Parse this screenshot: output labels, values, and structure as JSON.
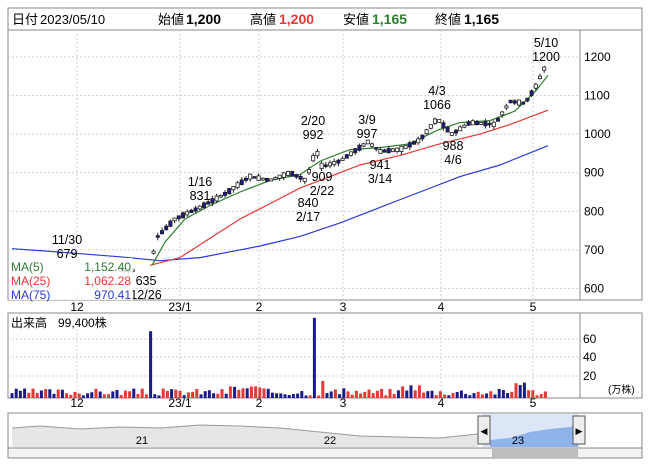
{
  "header": {
    "date_label": "日付",
    "date_value": "2023/05/10",
    "open_label": "始値",
    "open_value": "1,200",
    "high_label": "高値",
    "high_value": "1,200",
    "low_label": "安値",
    "low_value": "1,165",
    "close_label": "終値",
    "close_value": "1,165"
  },
  "legend": {
    "ma5": {
      "label": "MA(5)",
      "value": "1,152.40",
      "color": "#2e7d32"
    },
    "ma25": {
      "label": "MA(25)",
      "value": "1,062.28",
      "color": "#e53935"
    },
    "ma75": {
      "label": "MA(75)",
      "value": "970.41",
      "color": "#2a3bd6"
    }
  },
  "volume": {
    "label": "出来高",
    "value": "99,400株",
    "unit": "(万株)",
    "yticks": [
      "60",
      "40",
      "20"
    ]
  },
  "annotations": [
    {
      "lines": [
        "11/30",
        "679"
      ]
    },
    {
      "lines": [
        "635",
        "12/26"
      ]
    },
    {
      "lines": [
        "1/16",
        "831"
      ]
    },
    {
      "lines": [
        "2/20",
        "992"
      ]
    },
    {
      "lines": [
        "909",
        "2/22"
      ]
    },
    {
      "lines": [
        "840",
        "2/17"
      ]
    },
    {
      "lines": [
        "3/9",
        "997"
      ]
    },
    {
      "lines": [
        "941",
        "3/14"
      ]
    },
    {
      "lines": [
        "4/3",
        "1066"
      ]
    },
    {
      "lines": [
        "988",
        "4/6"
      ]
    },
    {
      "lines": [
        "5/10",
        "1200"
      ]
    }
  ],
  "navigator": {
    "labels": [
      "21",
      "22",
      "23"
    ]
  },
  "colors": {
    "up": "#ffffff",
    "down": "#1a1a8c",
    "ma5": "#2e7d32",
    "ma25": "#e53935",
    "ma75": "#2a3bd6",
    "vol_up": "#e53935",
    "vol_down": "#1a1a8c"
  },
  "chart_data": {
    "type": "candlestick",
    "ylim": [
      570,
      1270
    ],
    "yticks": [
      600,
      700,
      800,
      900,
      1000,
      1100,
      1200
    ],
    "xticks": [
      "12",
      "23/1",
      "2",
      "3",
      "4",
      "5"
    ],
    "anchors": [
      {
        "date": "11/30",
        "price": 679
      },
      {
        "date": "12/26",
        "price": 635
      },
      {
        "date": "1/16",
        "price": 831
      },
      {
        "date": "2/17",
        "price": 840
      },
      {
        "date": "2/20",
        "price": 992
      },
      {
        "date": "2/22",
        "price": 909
      },
      {
        "date": "3/9",
        "price": 997
      },
      {
        "date": "3/14",
        "price": 941
      },
      {
        "date": "4/3",
        "price": 1066
      },
      {
        "date": "4/6",
        "price": 988
      },
      {
        "date": "5/10",
        "price": 1200
      }
    ],
    "ma5_end": 1152.4,
    "ma25_end": 1062.28,
    "ma75_end": 970.41,
    "volume_last": 99400,
    "volume_ylim": [
      0,
      70
    ]
  }
}
